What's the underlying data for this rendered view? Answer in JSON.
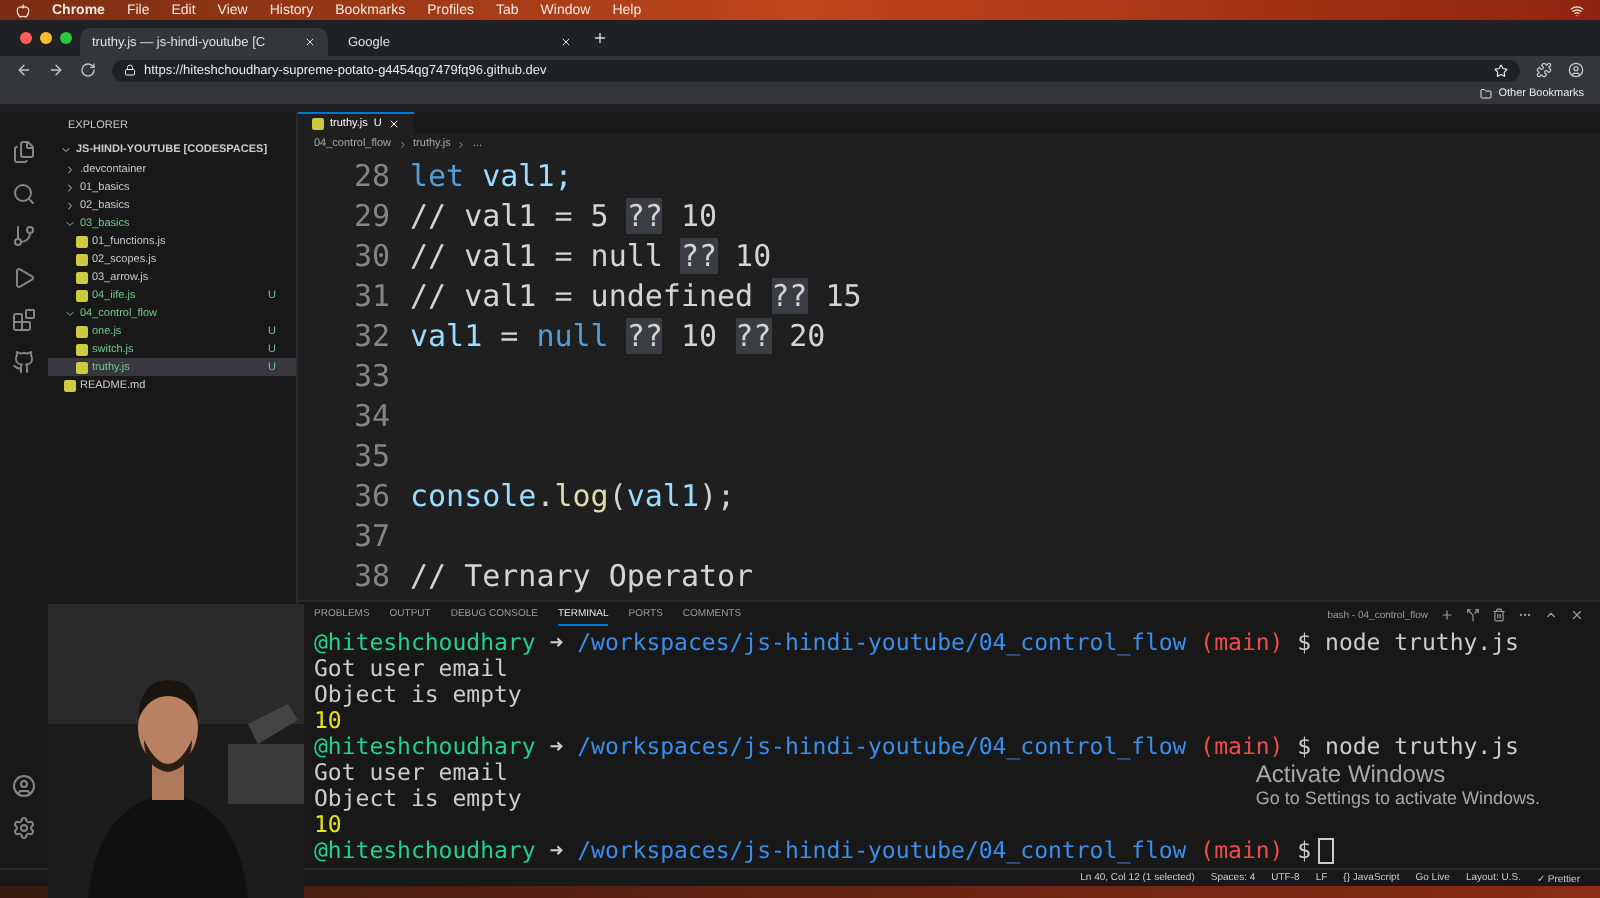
{
  "menu_bar": {
    "app": "Chrome",
    "items": [
      "File",
      "Edit",
      "View",
      "History",
      "Bookmarks",
      "Profiles",
      "Tab",
      "Window",
      "Help"
    ]
  },
  "browser_tabs": [
    {
      "title": "truthy.js — js-hindi-youtube [C",
      "selected": true
    },
    {
      "title": "Google",
      "selected": false
    }
  ],
  "address_bar": {
    "url": "https://hiteshchoudhary-supreme-potato-g4454qg7479fq96.github.dev"
  },
  "bookmarks_bar": {
    "items": [
      "Other Bookmarks"
    ]
  },
  "explorer": {
    "title": "EXPLORER",
    "root": "JS-HINDI-YOUTUBE [CODESPACES]",
    "items": [
      {
        "name": ".devcontainer",
        "kind": "folder",
        "expanded": false,
        "modified": false,
        "selected": false
      },
      {
        "name": "01_basics",
        "kind": "folder",
        "expanded": false,
        "modified": false,
        "selected": false
      },
      {
        "name": "02_basics",
        "kind": "folder",
        "expanded": false,
        "modified": false,
        "selected": false
      },
      {
        "name": "03_basics",
        "kind": "folder",
        "expanded": true,
        "modified": true,
        "selected": false,
        "children": [
          {
            "name": "01_functions.js",
            "kind": "file",
            "modified": false,
            "selected": false
          },
          {
            "name": "02_scopes.js",
            "kind": "file",
            "modified": false,
            "selected": false
          },
          {
            "name": "03_arrow.js",
            "kind": "file",
            "modified": false,
            "selected": false
          },
          {
            "name": "04_iife.js",
            "kind": "file",
            "modified": true,
            "badge": "U",
            "selected": false
          }
        ]
      },
      {
        "name": "04_control_flow",
        "kind": "folder",
        "expanded": true,
        "modified": true,
        "selected": false,
        "children": [
          {
            "name": "one.js",
            "kind": "file",
            "modified": true,
            "badge": "U",
            "selected": false
          },
          {
            "name": "switch.js",
            "kind": "file",
            "modified": true,
            "badge": "U",
            "selected": false
          },
          {
            "name": "truthy.js",
            "kind": "file",
            "modified": true,
            "badge": "U",
            "selected": true
          }
        ]
      },
      {
        "name": "README.md",
        "kind": "file",
        "modified": false,
        "selected": false
      }
    ]
  },
  "editor": {
    "tabs": [
      {
        "name": "truthy.js",
        "badge": "U",
        "selected": true
      }
    ],
    "breadcrumb": [
      "04_control_flow",
      "truthy.js",
      "..."
    ],
    "lines": [
      {
        "number": "28",
        "tokens": [
          {
            "text": "let",
            "kind": "keyword"
          },
          {
            "text": " val1;",
            "kind": "ident"
          }
        ]
      },
      {
        "number": "29",
        "tokens": [
          {
            "text": "// val1 = 5 ",
            "kind": "plain"
          },
          {
            "text": "??",
            "kind": "match"
          },
          {
            "text": " 10",
            "kind": "plain"
          }
        ]
      },
      {
        "number": "30",
        "tokens": [
          {
            "text": "// val1 = null ",
            "kind": "plain"
          },
          {
            "text": "??",
            "kind": "match"
          },
          {
            "text": " 10",
            "kind": "plain"
          }
        ]
      },
      {
        "number": "31",
        "tokens": [
          {
            "text": "// val1 = undefined ",
            "kind": "plain"
          },
          {
            "text": "??",
            "kind": "match"
          },
          {
            "text": " 15",
            "kind": "plain"
          }
        ]
      },
      {
        "number": "32",
        "tokens": [
          {
            "text": "val1",
            "kind": "ident"
          },
          {
            "text": " = ",
            "kind": "plain"
          },
          {
            "text": "null ",
            "kind": "keyword"
          },
          {
            "text": "??",
            "kind": "match"
          },
          {
            "text": " 10 ",
            "kind": "plain"
          },
          {
            "text": "??",
            "kind": "match"
          },
          {
            "text": " 20",
            "kind": "plain"
          }
        ]
      },
      {
        "number": "33"
      },
      {
        "number": "34"
      },
      {
        "number": "35"
      },
      {
        "number": "36",
        "tokens": [
          {
            "text": "console",
            "kind": "ident"
          },
          {
            "text": ".",
            "kind": "plain"
          },
          {
            "text": "log",
            "kind": "func"
          },
          {
            "text": "(",
            "kind": "plain"
          },
          {
            "text": "val1",
            "kind": "ident"
          },
          {
            "text": ");",
            "kind": "plain"
          }
        ]
      },
      {
        "number": "37"
      },
      {
        "number": "38",
        "tokens": [
          {
            "text": "// Ternary Operator",
            "kind": "plain"
          }
        ]
      }
    ]
  },
  "panel": {
    "tabs": [
      {
        "label": "PROBLEMS",
        "selected": false
      },
      {
        "label": "OUTPUT",
        "selected": false
      },
      {
        "label": "DEBUG CONSOLE",
        "selected": false
      },
      {
        "label": "TERMINAL",
        "selected": true
      },
      {
        "label": "PORTS",
        "selected": false
      },
      {
        "label": "COMMENTS",
        "selected": false
      }
    ],
    "terminal_name": "bash - 04_control_flow",
    "lines": [
      {
        "kind": "prompt",
        "user": "@hiteshchoudhary",
        "arrow": "➜",
        "path": "/workspaces/js-hindi-youtube/04_control_flow",
        "branch": "(main)",
        "sign": "$",
        "command": "node truthy.js"
      },
      {
        "kind": "output",
        "text": "Got user email"
      },
      {
        "kind": "output",
        "text": "Object is empty"
      },
      {
        "kind": "value",
        "text": "10"
      },
      {
        "kind": "prompt",
        "user": "@hiteshchoudhary",
        "arrow": "➜",
        "path": "/workspaces/js-hindi-youtube/04_control_flow",
        "branch": "(main)",
        "sign": "$",
        "command": "node truthy.js"
      },
      {
        "kind": "output",
        "text": "Got user email"
      },
      {
        "kind": "output",
        "text": "Object is empty"
      },
      {
        "kind": "value",
        "text": "10"
      },
      {
        "kind": "prompt",
        "user": "@hiteshchoudhary",
        "arrow": "➜",
        "path": "/workspaces/js-hindi-youtube/04_control_flow",
        "branch": "(main)",
        "sign": "$"
      }
    ]
  },
  "activation_notice": {
    "title": "Activate Windows",
    "text": "Go to Settings to activate Windows."
  },
  "status_bar": {
    "items": [
      "Ln 40, Col 12 (1 selected)",
      "Spaces: 4",
      "UTF-8",
      "LF",
      "{} JavaScript",
      "Go Live",
      "Layout: U.S.",
      "✓ Prettier"
    ]
  }
}
